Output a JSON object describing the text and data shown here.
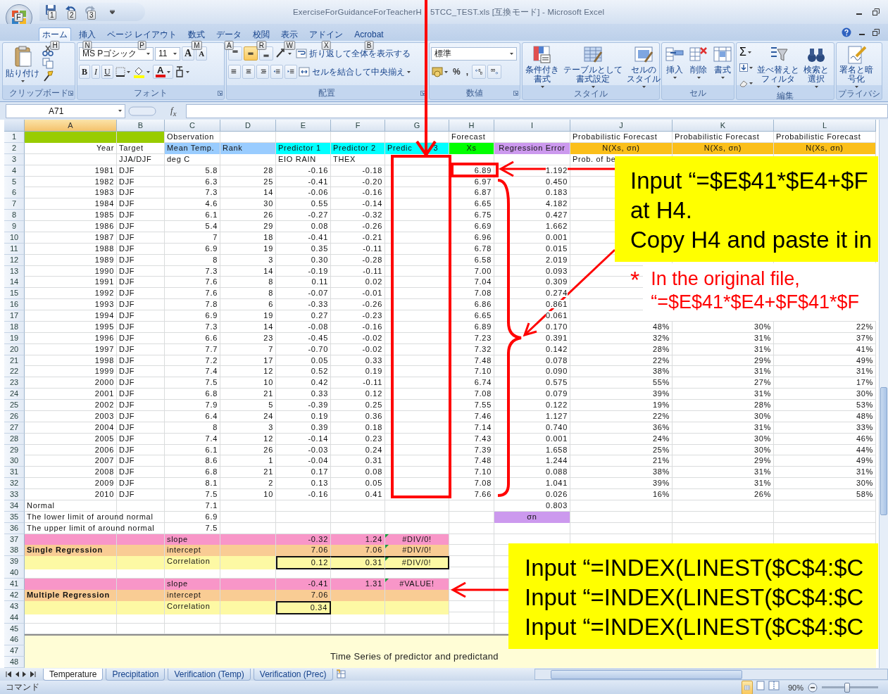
{
  "window": {
    "title_parts": [
      "ExerciseForGuidanceForTeacherH",
      "5TCC_TEST.xls  [互換モード] - Microsoft Excel"
    ]
  },
  "office_button": {
    "keytip": "F"
  },
  "quick_access": [
    {
      "keytip": "1"
    },
    {
      "keytip": "2"
    },
    {
      "keytip": "3"
    }
  ],
  "tabs": [
    {
      "label": "ホーム",
      "keytip": "H",
      "selected": true
    },
    {
      "label": "挿入",
      "keytip": "N",
      "selected": false
    },
    {
      "label": "ページ レイアウト",
      "keytip": "P",
      "selected": false
    },
    {
      "label": "数式",
      "keytip": "M",
      "selected": false
    },
    {
      "label": "データ",
      "keytip": "A",
      "selected": false
    },
    {
      "label": "校閲",
      "keytip": "R",
      "selected": false
    },
    {
      "label": "表示",
      "keytip": "W",
      "selected": false
    },
    {
      "label": "アドイン",
      "keytip": "X",
      "selected": false
    },
    {
      "label": "Acrobat",
      "keytip": "B",
      "selected": false
    }
  ],
  "ribbon": {
    "groups": [
      {
        "kind": "clipboard",
        "label": "クリップボード",
        "paste": "貼り付け"
      },
      {
        "kind": "font",
        "label": "フォント",
        "font_name": "MS Pゴシック",
        "font_size": "11",
        "grow": "A",
        "shrink": "A",
        "bold": "B",
        "italic": "I",
        "underline": "U",
        "font_color": "A"
      },
      {
        "kind": "alignment",
        "label": "配置",
        "vertical": [
          {
            "selected": false
          },
          {
            "selected": true
          },
          {
            "selected": false
          }
        ],
        "wrap": "折り返して全体を表示する",
        "merge": "セルを結合して中央揃え"
      },
      {
        "kind": "number",
        "label": "数値",
        "format": "標準",
        "percent": "%",
        "comma": ","
      },
      {
        "kind": "buttons",
        "label": "スタイル",
        "buttons": [
          {
            "lines": [
              "条件付き",
              "書式"
            ]
          },
          {
            "lines": [
              "テーブルとして",
              "書式設定"
            ]
          },
          {
            "lines": [
              "セルの",
              "スタイル"
            ]
          }
        ]
      },
      {
        "kind": "buttons",
        "label": "セル",
        "buttons": [
          {
            "lines": [
              "挿入"
            ]
          },
          {
            "lines": [
              "削除"
            ]
          },
          {
            "lines": [
              "書式"
            ]
          }
        ]
      },
      {
        "kind": "editing",
        "label": "編集",
        "autosum": "Σ",
        "buttons": [
          {
            "lines": [
              "並べ替えと",
              "フィルタ"
            ]
          },
          {
            "lines": [
              "検索と",
              "選択"
            ]
          }
        ]
      },
      {
        "kind": "buttons",
        "label": "プライバシ",
        "buttons": [
          {
            "lines": [
              "署名と暗",
              "号化"
            ]
          }
        ]
      }
    ]
  },
  "formula_bar": {
    "name_box": "A71",
    "fx": "f$_{x}$"
  },
  "sheet": {
    "columns": [
      {
        "label": "A",
        "selected": true
      },
      {
        "label": "B",
        "selected": false
      },
      {
        "label": "C",
        "selected": false
      },
      {
        "label": "D",
        "selected": false
      },
      {
        "label": "E",
        "selected": false
      },
      {
        "label": "F",
        "selected": false
      },
      {
        "label": "G",
        "selected": false
      },
      {
        "label": "H",
        "selected": false
      },
      {
        "label": "I",
        "selected": false
      },
      {
        "label": "J",
        "selected": false
      },
      {
        "label": "K",
        "selected": false
      },
      {
        "label": "L",
        "selected": false
      }
    ],
    "rows": [
      {
        "n": "1",
        "kind": "text",
        "cells": {
          "C": "Observation",
          "H": "Forecast",
          "J": "Probabilistic Forecast",
          "K": "Probabilistic Forecast",
          "L": "Probabilistic Forecast"
        },
        "fills": {
          "A": {
            "color": "#99cc00"
          },
          "B": {
            "color": "#99cc00"
          }
        }
      },
      {
        "n": "2",
        "kind": "text",
        "cells": {
          "A": {
            "text": "Year",
            "kind": "number"
          },
          "B": "Target",
          "C": "Mean Temp.",
          "D": "Rank",
          "E": "Predictor 1",
          "F": "Predictor 2",
          "G": [
            "Predic",
            "3"
          ],
          "H": {
            "text": "Xs",
            "kind": "heading"
          },
          "I": {
            "text": "Regression Error",
            "kind": "heading"
          },
          "J": {
            "text": "N(Xs, σn)",
            "kind": "heading"
          },
          "K": {
            "text": "N(Xs, σn)",
            "kind": "heading"
          },
          "L": {
            "text": "N(Xs, σn)",
            "kind": "heading"
          }
        },
        "fills": {
          "C": {
            "color": "#99ccff"
          },
          "D": {
            "color": "#99ccff"
          },
          "E": {
            "color": "#00ffff"
          },
          "F": {
            "color": "#00ffff"
          },
          "G": {
            "color": "#00ffff"
          },
          "H": {
            "color": "#00ff00"
          },
          "I": {
            "color": "#cc99ee"
          },
          "J": {
            "color": "#fbbf1a"
          },
          "K": {
            "color": "#fbbf1a"
          },
          "L": {
            "color": "#fbbf1a"
          }
        }
      },
      {
        "n": "3",
        "kind": "text",
        "cells": {
          "B": "JJA/DJF",
          "C": "deg C",
          "E": "EIO RAIN",
          "F": "THEX",
          "J": "Prob. of be"
        }
      },
      {
        "n": "4",
        "kind": "data",
        "cells": {
          "A": "1981",
          "B": "DJF",
          "C": "5.8",
          "D": "28",
          "E": "-0.16",
          "F": "-0.18",
          "H": "6.89",
          "I": "1.192"
        }
      },
      {
        "n": "5",
        "kind": "data",
        "cells": {
          "A": "1982",
          "B": "DJF",
          "C": "6.3",
          "D": "25",
          "E": "-0.41",
          "F": "-0.20",
          "H": "6.97",
          "I": "0.450"
        }
      },
      {
        "n": "6",
        "kind": "data",
        "cells": {
          "A": "1983",
          "B": "DJF",
          "C": "7.3",
          "D": "14",
          "E": "-0.06",
          "F": "-0.16",
          "H": "6.87",
          "I": "0.183"
        }
      },
      {
        "n": "7",
        "kind": "data",
        "cells": {
          "A": "1984",
          "B": "DJF",
          "C": "4.6",
          "D": "30",
          "E": "0.55",
          "F": "-0.14",
          "H": "6.65",
          "I": "4.182"
        }
      },
      {
        "n": "8",
        "kind": "data",
        "cells": {
          "A": "1985",
          "B": "DJF",
          "C": "6.1",
          "D": "26",
          "E": "-0.27",
          "F": "-0.32",
          "H": "6.75",
          "I": "0.427"
        }
      },
      {
        "n": "9",
        "kind": "data",
        "cells": {
          "A": "1986",
          "B": "DJF",
          "C": "5.4",
          "D": "29",
          "E": "0.08",
          "F": "-0.26",
          "H": "6.69",
          "I": "1.662"
        }
      },
      {
        "n": "10",
        "kind": "data",
        "cells": {
          "A": "1987",
          "B": "DJF",
          "C": "7",
          "D": "18",
          "E": "-0.41",
          "F": "-0.21",
          "H": "6.96",
          "I": "0.001"
        }
      },
      {
        "n": "11",
        "kind": "data",
        "cells": {
          "A": "1988",
          "B": "DJF",
          "C": "6.9",
          "D": "19",
          "E": "0.35",
          "F": "-0.11",
          "H": "6.78",
          "I": "0.015"
        }
      },
      {
        "n": "12",
        "kind": "data",
        "cells": {
          "A": "1989",
          "B": "DJF",
          "C": "8",
          "D": "3",
          "E": "0.30",
          "F": "-0.28",
          "H": "6.58",
          "I": "2.019"
        }
      },
      {
        "n": "13",
        "kind": "data",
        "cells": {
          "A": "1990",
          "B": "DJF",
          "C": "7.3",
          "D": "14",
          "E": "-0.19",
          "F": "-0.11",
          "H": "7.00",
          "I": "0.093"
        }
      },
      {
        "n": "14",
        "kind": "data",
        "cells": {
          "A": "1991",
          "B": "DJF",
          "C": "7.6",
          "D": "8",
          "E": "0.11",
          "F": "0.02",
          "H": "7.04",
          "I": "0.309"
        }
      },
      {
        "n": "15",
        "kind": "data",
        "cells": {
          "A": "1992",
          "B": "DJF",
          "C": "7.6",
          "D": "8",
          "E": "-0.07",
          "F": "-0.01",
          "H": "7.08",
          "I": "0.274"
        }
      },
      {
        "n": "16",
        "kind": "data",
        "cells": {
          "A": "1993",
          "B": "DJF",
          "C": "7.8",
          "D": "6",
          "E": "-0.33",
          "F": "-0.26",
          "H": "6.86",
          "I": "0.861"
        }
      },
      {
        "n": "17",
        "kind": "data",
        "cells": {
          "A": "1994",
          "B": "DJF",
          "C": "6.9",
          "D": "19",
          "E": "0.27",
          "F": "-0.23",
          "H": "6.65",
          "I": "0.061"
        }
      },
      {
        "n": "18",
        "kind": "data",
        "cells": {
          "A": "1995",
          "B": "DJF",
          "C": "7.3",
          "D": "14",
          "E": "-0.08",
          "F": "-0.16",
          "H": "6.89",
          "I": "0.170",
          "J": "48%",
          "K": "30%",
          "L": "22%"
        }
      },
      {
        "n": "19",
        "kind": "data",
        "cells": {
          "A": "1996",
          "B": "DJF",
          "C": "6.6",
          "D": "23",
          "E": "-0.45",
          "F": "-0.02",
          "H": "7.23",
          "I": "0.391",
          "J": "32%",
          "K": "31%",
          "L": "37%"
        }
      },
      {
        "n": "20",
        "kind": "data",
        "cells": {
          "A": "1997",
          "B": "DJF",
          "C": "7.7",
          "D": "7",
          "E": "-0.70",
          "F": "-0.02",
          "H": "7.32",
          "I": "0.142",
          "J": "28%",
          "K": "31%",
          "L": "41%"
        }
      },
      {
        "n": "21",
        "kind": "data",
        "cells": {
          "A": "1998",
          "B": "DJF",
          "C": "7.2",
          "D": "17",
          "E": "0.05",
          "F": "0.33",
          "H": "7.48",
          "I": "0.078",
          "J": "22%",
          "K": "29%",
          "L": "49%"
        }
      },
      {
        "n": "22",
        "kind": "data",
        "cells": {
          "A": "1999",
          "B": "DJF",
          "C": "7.4",
          "D": "12",
          "E": "0.52",
          "F": "0.19",
          "H": "7.10",
          "I": "0.090",
          "J": "38%",
          "K": "31%",
          "L": "31%"
        }
      },
      {
        "n": "23",
        "kind": "data",
        "cells": {
          "A": "2000",
          "B": "DJF",
          "C": "7.5",
          "D": "10",
          "E": "0.42",
          "F": "-0.11",
          "H": "6.74",
          "I": "0.575",
          "J": "55%",
          "K": "27%",
          "L": "17%"
        }
      },
      {
        "n": "24",
        "kind": "data",
        "cells": {
          "A": "2001",
          "B": "DJF",
          "C": "6.8",
          "D": "21",
          "E": "0.33",
          "F": "0.12",
          "H": "7.08",
          "I": "0.079",
          "J": "39%",
          "K": "31%",
          "L": "30%"
        }
      },
      {
        "n": "25",
        "kind": "data",
        "cells": {
          "A": "2002",
          "B": "DJF",
          "C": "7.9",
          "D": "5",
          "E": "-0.39",
          "F": "0.25",
          "H": "7.55",
          "I": "0.122",
          "J": "19%",
          "K": "28%",
          "L": "53%"
        }
      },
      {
        "n": "26",
        "kind": "data",
        "cells": {
          "A": "2003",
          "B": "DJF",
          "C": "6.4",
          "D": "24",
          "E": "0.19",
          "F": "0.36",
          "H": "7.46",
          "I": "1.127",
          "J": "22%",
          "K": "30%",
          "L": "48%"
        }
      },
      {
        "n": "27",
        "kind": "data",
        "cells": {
          "A": "2004",
          "B": "DJF",
          "C": "8",
          "D": "3",
          "E": "0.39",
          "F": "0.18",
          "H": "7.14",
          "I": "0.740",
          "J": "36%",
          "K": "31%",
          "L": "33%"
        }
      },
      {
        "n": "28",
        "kind": "data",
        "cells": {
          "A": "2005",
          "B": "DJF",
          "C": "7.4",
          "D": "12",
          "E": "-0.14",
          "F": "0.23",
          "H": "7.43",
          "I": "0.001",
          "J": "24%",
          "K": "30%",
          "L": "46%"
        }
      },
      {
        "n": "29",
        "kind": "data",
        "cells": {
          "A": "2006",
          "B": "DJF",
          "C": "6.1",
          "D": "26",
          "E": "-0.03",
          "F": "0.24",
          "H": "7.39",
          "I": "1.658",
          "J": "25%",
          "K": "30%",
          "L": "44%"
        }
      },
      {
        "n": "30",
        "kind": "data",
        "cells": {
          "A": "2007",
          "B": "DJF",
          "C": "8.6",
          "D": "1",
          "E": "-0.04",
          "F": "0.31",
          "H": "7.48",
          "I": "1.244",
          "J": "21%",
          "K": "29%",
          "L": "49%"
        }
      },
      {
        "n": "31",
        "kind": "data",
        "cells": {
          "A": "2008",
          "B": "DJF",
          "C": "6.8",
          "D": "21",
          "E": "0.17",
          "F": "0.08",
          "H": "7.10",
          "I": "0.088",
          "J": "38%",
          "K": "31%",
          "L": "31%"
        }
      },
      {
        "n": "32",
        "kind": "data",
        "cells": {
          "A": "2009",
          "B": "DJF",
          "C": "8.1",
          "D": "2",
          "E": "0.13",
          "F": "0.05",
          "H": "7.08",
          "I": "1.041",
          "J": "39%",
          "K": "31%",
          "L": "30%"
        }
      },
      {
        "n": "33",
        "kind": "data",
        "cells": {
          "A": "2010",
          "B": "DJF",
          "C": "7.5",
          "D": "10",
          "E": "-0.16",
          "F": "0.41",
          "H": "7.66",
          "I": "0.026",
          "J": "16%",
          "K": "26%",
          "L": "58%"
        }
      },
      {
        "n": "34",
        "kind": "text",
        "cells": {
          "A": "Normal",
          "C": {
            "text": "7.1",
            "kind": "number"
          },
          "I": {
            "text": "0.803",
            "kind": "number"
          }
        }
      },
      {
        "n": "35",
        "kind": "text",
        "cells": {
          "A": "The lower limit of around normal",
          "C": {
            "text": "6.9",
            "kind": "number"
          },
          "I": {
            "text": "σn",
            "kind": "heading"
          }
        },
        "fills": {
          "I": {
            "color": "#cc99ee"
          }
        }
      },
      {
        "n": "36",
        "kind": "text",
        "cells": {
          "A": "The upper limit of around normal",
          "C": {
            "text": "7.5",
            "kind": "number"
          }
        }
      },
      {
        "n": "37",
        "kind": "text",
        "band": {
          "color": "#f896c8"
        },
        "cells": {
          "C": "slope",
          "E": {
            "text": "-0.32",
            "kind": "number"
          },
          "F": {
            "text": "1.24",
            "kind": "number"
          },
          "G": {
            "text": "#DIV/0!",
            "kind": "error",
            "flagged": true
          }
        }
      },
      {
        "n": "38",
        "kind": "text",
        "band": {
          "color": "#f9cc94"
        },
        "cells": {
          "A": {
            "text": "Single Regression",
            "kind": "title"
          },
          "C": "intercept",
          "E": {
            "text": "7.06",
            "kind": "number"
          },
          "F": {
            "text": "7.06",
            "kind": "number"
          },
          "G": {
            "text": "#DIV/0!",
            "kind": "error",
            "flagged": true
          }
        }
      },
      {
        "n": "39",
        "kind": "text",
        "band": {
          "color": "#fdf9a4"
        },
        "cells": {
          "C": "Correlation",
          "E": {
            "text": "0.12",
            "kind": "number",
            "boxed": true
          },
          "F": {
            "text": "0.31",
            "kind": "number",
            "boxed": true
          },
          "G": {
            "text": "#DIV/0!",
            "kind": "error",
            "flagged": true,
            "boxed": true
          }
        }
      },
      {
        "n": "40",
        "kind": "text"
      },
      {
        "n": "41",
        "kind": "text",
        "band": {
          "color": "#f896c8"
        },
        "cells": {
          "C": "slope",
          "E": {
            "text": "-0.41",
            "kind": "number"
          },
          "F": {
            "text": "1.31",
            "kind": "number"
          },
          "G": {
            "text": "#VALUE!",
            "kind": "error",
            "flagged": true
          }
        }
      },
      {
        "n": "42",
        "kind": "text",
        "band": {
          "color": "#f9cc94"
        },
        "cells": {
          "A": {
            "text": "Multiple Regression",
            "kind": "title"
          },
          "C": "intercept",
          "E": {
            "text": "7.06",
            "kind": "number"
          }
        }
      },
      {
        "n": "43",
        "kind": "text",
        "band": {
          "color": "#fdf9a4"
        },
        "cells": {
          "C": "Correlation",
          "E": {
            "text": "0.34",
            "kind": "number",
            "boxed": true
          }
        }
      },
      {
        "n": "44",
        "kind": "text"
      },
      {
        "n": "45",
        "kind": "text"
      },
      {
        "n": "46",
        "kind": "text"
      },
      {
        "n": "47",
        "kind": "text"
      },
      {
        "n": "48",
        "kind": "text"
      }
    ],
    "chart": {
      "title": "Time Series of predictor and predictand"
    }
  },
  "sheet_tabs": [
    {
      "label": "Temperature",
      "selected": true
    },
    {
      "label": "Precipitation",
      "selected": false
    },
    {
      "label": "Verification (Temp)",
      "selected": false
    },
    {
      "label": "Verification (Prec)",
      "selected": false
    }
  ],
  "status_bar": {
    "mode": "コマンド",
    "zoom": "90%",
    "zoom_slider": {
      "level": 0.45
    }
  },
  "callouts": [
    {
      "lines": [
        "Input “=$E$41*$E4+$F",
        "at H4.",
        "Copy H4 and paste it in"
      ]
    },
    {
      "lines": [
        "Input “=INDEX(LINEST($C$4:$C",
        "Input “=INDEX(LINEST($C$4:$C",
        "Input “=INDEX(LINEST($C$4:$C"
      ]
    }
  ],
  "note": {
    "mark": "*",
    "lines": [
      "In the original file,",
      "“=$E$41*$E4+$F$41*$F"
    ]
  }
}
